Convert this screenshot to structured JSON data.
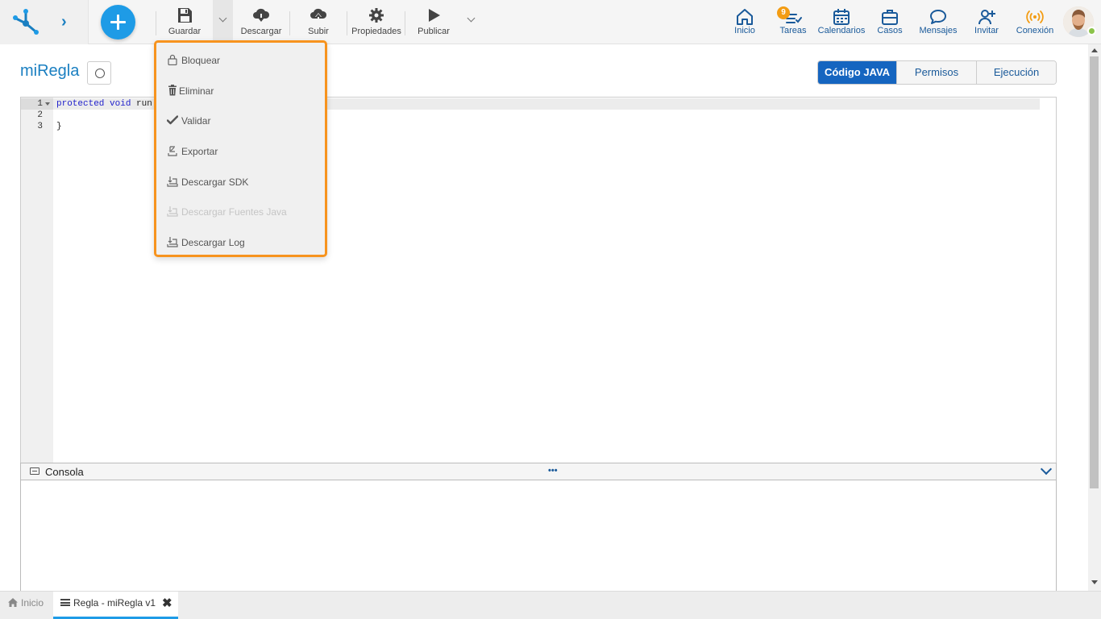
{
  "toolbar": {
    "guardar": "Guardar",
    "descargar": "Descargar",
    "subir": "Subir",
    "propiedades": "Propiedades",
    "publicar": "Publicar"
  },
  "nav": {
    "inicio": "Inicio",
    "tareas": "Tareas",
    "tareas_badge": "9",
    "calendarios": "Calendarios",
    "casos": "Casos",
    "mensajes": "Mensajes",
    "invitar": "Invitar",
    "conexion": "Conexión"
  },
  "page": {
    "title": "miRegla"
  },
  "tabs": [
    {
      "label": "Código JAVA",
      "active": true
    },
    {
      "label": "Permisos",
      "active": false
    },
    {
      "label": "Ejecución",
      "active": false
    }
  ],
  "editor": {
    "line_numbers": [
      "1",
      "2",
      "3"
    ],
    "keyword_protected": "protected",
    "keyword_void": "void",
    "method_fragment": "run",
    "closing_brace": "}"
  },
  "console": {
    "title": "Consola",
    "dots": "•••"
  },
  "dropdown": {
    "items": [
      {
        "label": "Bloquear",
        "icon": "lock-icon",
        "enabled": true
      },
      {
        "label": "Eliminar",
        "icon": "trash-icon",
        "enabled": true
      },
      {
        "label": "Validar",
        "icon": "check-icon",
        "enabled": true
      },
      {
        "label": "Exportar",
        "icon": "export-icon",
        "enabled": true
      },
      {
        "label": "Descargar SDK",
        "icon": "download-icon",
        "enabled": true
      },
      {
        "label": "Descargar Fuentes Java",
        "icon": "download-icon",
        "enabled": false
      },
      {
        "label": "Descargar Log",
        "icon": "download-icon",
        "enabled": true
      }
    ]
  },
  "bottom_tabs": {
    "home": "Inicio",
    "rule": "Regla - miRegla v1",
    "close": "✖"
  },
  "colors": {
    "accent": "#1e9be6",
    "active_tab": "#1565c0",
    "dropdown_border": "#f7931e",
    "badge": "#f39c12"
  }
}
